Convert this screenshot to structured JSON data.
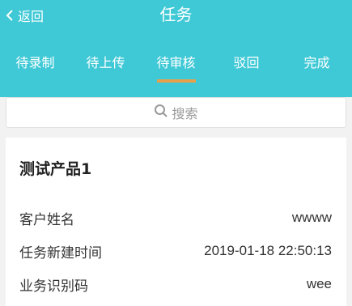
{
  "header": {
    "back_label": "返回",
    "title": "任务",
    "bg_color": "#3fc9d6",
    "indicator_color": "#e8a14a"
  },
  "tabs": [
    {
      "label": "待录制",
      "active": false
    },
    {
      "label": "待上传",
      "active": false
    },
    {
      "label": "待审核",
      "active": true
    },
    {
      "label": "驳回",
      "active": false
    },
    {
      "label": "完成",
      "active": false
    }
  ],
  "search": {
    "placeholder": "搜索",
    "icon": "search-icon"
  },
  "task_card": {
    "product_name": "测试产品1",
    "fields": [
      {
        "label": "客户姓名",
        "value": "wwww"
      },
      {
        "label": "任务新建时间",
        "value": "2019-01-18 22:50:13"
      },
      {
        "label": "业务识别码",
        "value": "wee"
      }
    ]
  }
}
